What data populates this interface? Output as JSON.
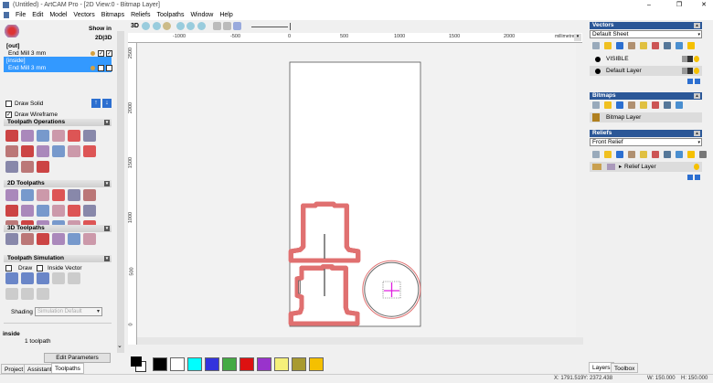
{
  "window": {
    "title": "(Untitled) - ArtCAM Pro - [2D View:0 - Bitmap Layer]",
    "minimize": "–",
    "restore": "❐",
    "close": "✕"
  },
  "menu": [
    "File",
    "Edit",
    "Model",
    "Vectors",
    "Bitmaps",
    "Reliefs",
    "Toolpaths",
    "Window",
    "Help"
  ],
  "left_panel": {
    "show_in": "Show in",
    "show_in_modes": "2D|3D",
    "toolpaths": [
      {
        "group": "[out]",
        "tool": "End Mill 3 mm",
        "selected": false
      },
      {
        "group": "[inside]",
        "tool": "End Mill 3 mm",
        "selected": true
      }
    ],
    "draw_solid": "Draw Solid",
    "draw_wireframe": "Draw Wireframe",
    "sections": [
      "Toolpath Operations",
      "2D Toolpaths",
      "3D Toolpaths",
      "Toolpath Simulation"
    ],
    "sim_draw": "Draw",
    "sim_inside_vector": "Inside Vector",
    "shading_label": "Shading",
    "shading_value": "Simulation Default",
    "info_title": "inside",
    "info_count": "1 toolpath",
    "edit_parameters": "Edit Parameters",
    "tabs": [
      "Project",
      "Assistant",
      "Toolpaths"
    ]
  },
  "view_toolbar": {
    "mode_3d": "3D"
  },
  "ruler": {
    "h_ticks": [
      "-1000",
      "-500",
      "0",
      "500",
      "1000",
      "1500",
      "2000"
    ],
    "units": "millimetres",
    "v_ticks": [
      "2500",
      "2000",
      "1500",
      "1000",
      "500",
      "0"
    ]
  },
  "palette": [
    "#000000",
    "#ffffff",
    "#00ffff",
    "#3333dd",
    "#44aa44",
    "#dd1111",
    "#9933cc",
    "#f5f07a",
    "#a89a30",
    "#f5c000"
  ],
  "right_panel": {
    "vectors": {
      "title": "Vectors",
      "sheet": "Default Sheet",
      "layers": [
        "VISIBLE",
        "Default Layer"
      ]
    },
    "bitmaps": {
      "title": "Bitmaps",
      "layers": [
        "Bitmap Layer"
      ]
    },
    "reliefs": {
      "title": "Reliefs",
      "relief": "Front Relief",
      "layers": [
        "Relief Layer"
      ]
    },
    "tabs": [
      "Layers",
      "Toolbox"
    ]
  },
  "status": {
    "x": "X: 1791.519",
    "y": "Y: 2372.438",
    "w": "W: 150.000",
    "h": "H: 150.000"
  }
}
